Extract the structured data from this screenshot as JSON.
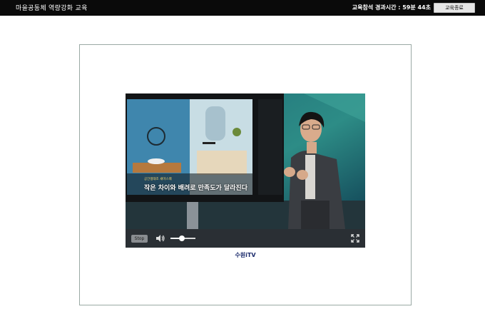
{
  "header": {
    "title": "마을공동체 역량강화 교육",
    "elapsed_text": "교육참석 경과시간 : 59분 44초",
    "end_button": "교육종료"
  },
  "video": {
    "caption_small": "공간생태조 새마스웨",
    "caption_main": "작은 차이와 배려로 만족도가 달라진다"
  },
  "player": {
    "stop_label": "Stop",
    "volume_level": 0.45
  },
  "brand": {
    "text": "수원iTV"
  },
  "colors": {
    "topbar": "#0a0a0a",
    "frame_border": "#9aa9a4",
    "player_bar": "#2a2f34",
    "brand_text": "#1a2a6b"
  }
}
